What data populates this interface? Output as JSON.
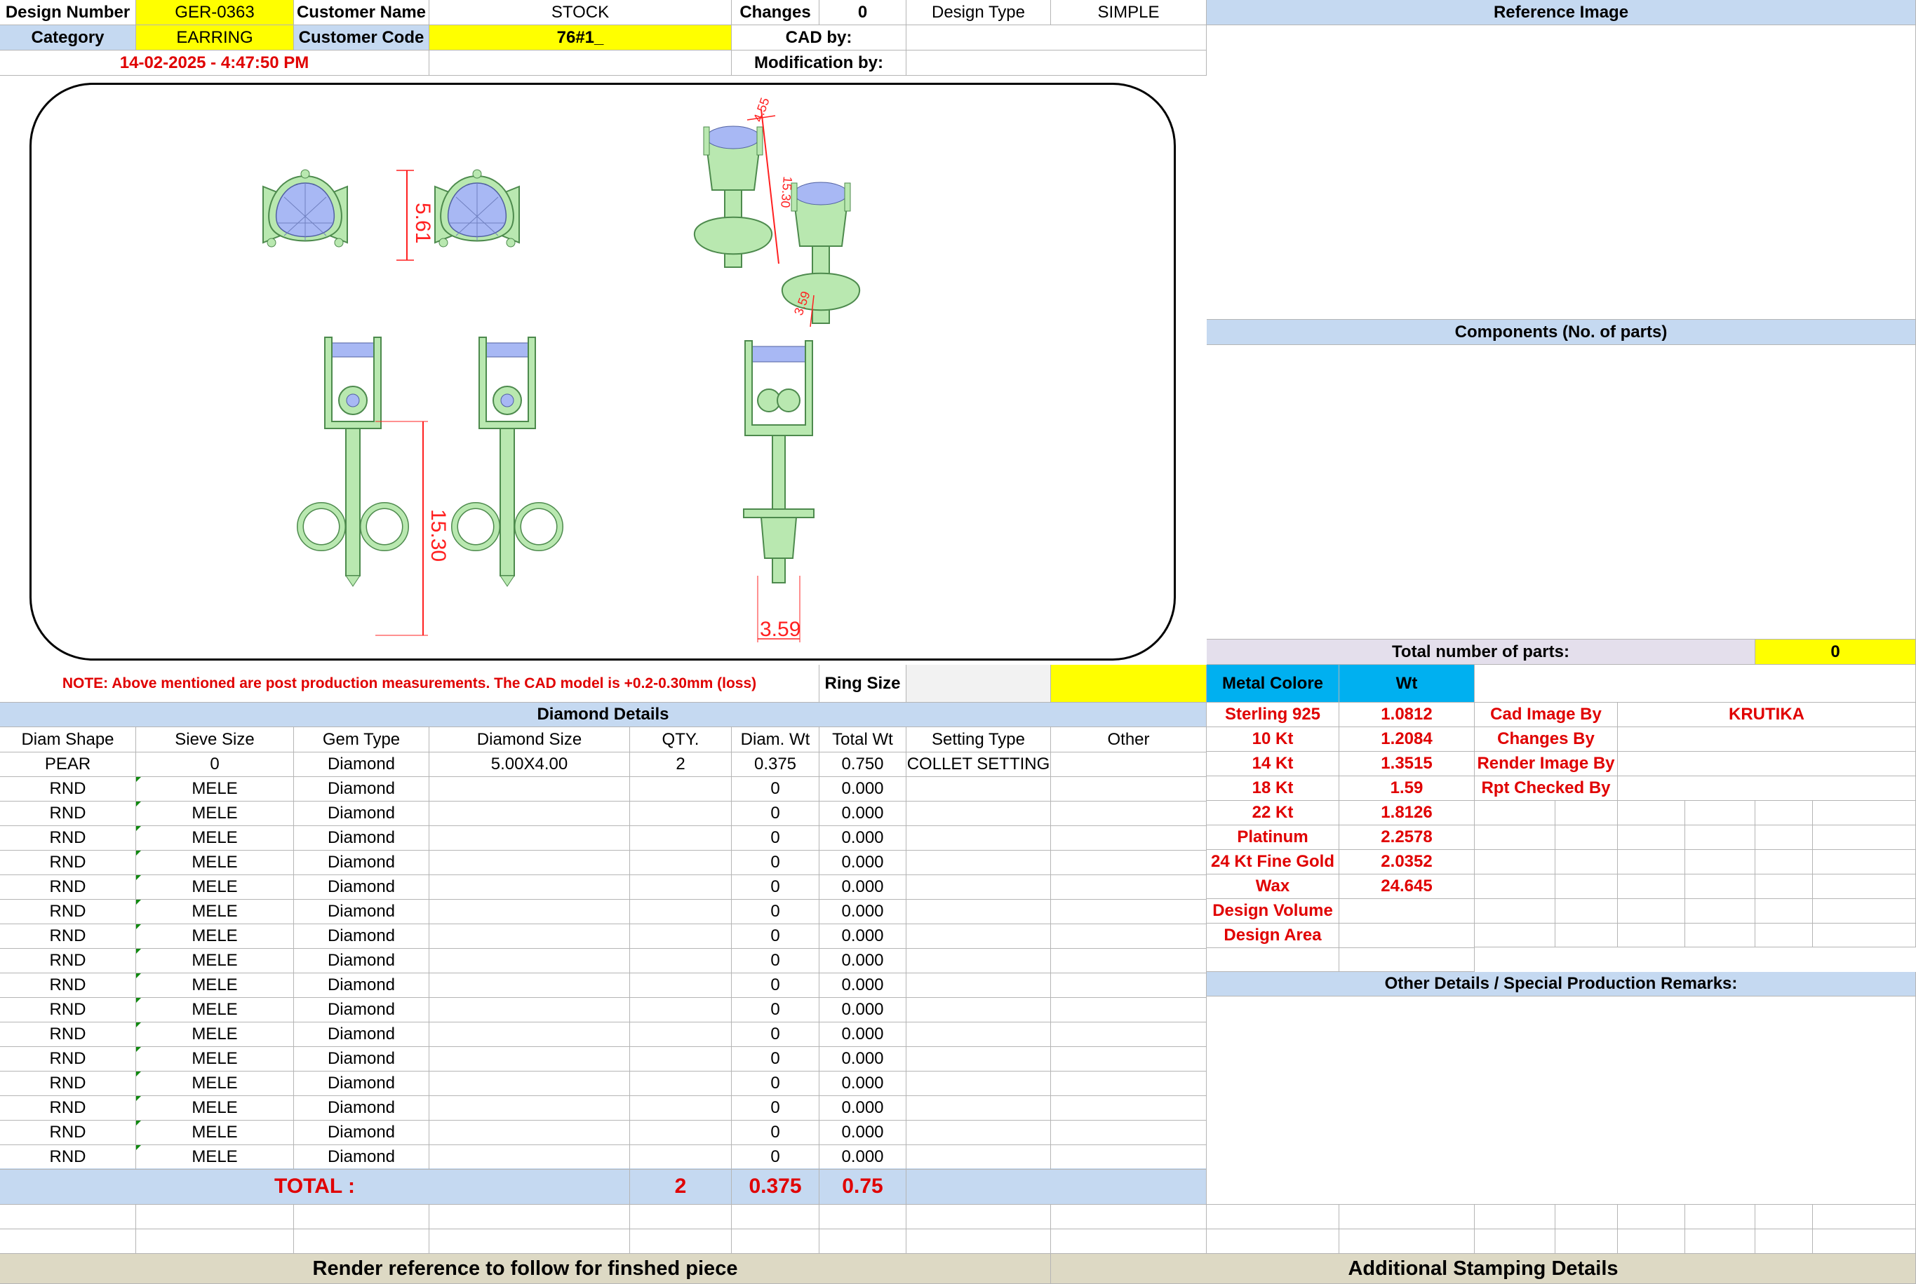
{
  "header": {
    "design_number_label": "Design Number",
    "design_number": "GER-0363",
    "customer_name_label": "Customer Name",
    "customer_name": "STOCK",
    "changes_label": "Changes",
    "changes": "0",
    "design_type_label": "Design Type",
    "design_type": "SIMPLE",
    "reference_image_label": "Reference Image",
    "category_label": "Category",
    "category": "EARRING",
    "customer_code_label": "Customer Code",
    "customer_code": "76#1_",
    "cad_by_label": "CAD by:",
    "datetime": "14-02-2025 - 4:47:50 PM",
    "modification_by_label": "Modification by:"
  },
  "drawing": {
    "dims": {
      "top_width": "5.61",
      "side_height": "15.30",
      "side_small1": "4.55",
      "side_small2": "3.59",
      "front_height": "15.30",
      "bottom_width": "3.59"
    }
  },
  "note": "NOTE: Above mentioned are post production measurements. The CAD model is +0.2-0.30mm (loss)",
  "ring_size_label": "Ring Size",
  "diamond": {
    "section_title": "Diamond Details",
    "headers": [
      "Diam Shape",
      "Sieve Size",
      "Gem Type",
      "Diamond Size",
      "QTY.",
      "Diam. Wt",
      "Total Wt",
      "Setting Type",
      "Other"
    ],
    "rows": [
      [
        "PEAR",
        "0",
        "Diamond",
        "5.00X4.00",
        "2",
        "0.375",
        "0.750",
        "COLLET SETTING",
        ""
      ],
      [
        "RND",
        "MELE",
        "Diamond",
        "",
        "",
        "0",
        "0.000",
        "",
        ""
      ],
      [
        "RND",
        "MELE",
        "Diamond",
        "",
        "",
        "0",
        "0.000",
        "",
        ""
      ],
      [
        "RND",
        "MELE",
        "Diamond",
        "",
        "",
        "0",
        "0.000",
        "",
        ""
      ],
      [
        "RND",
        "MELE",
        "Diamond",
        "",
        "",
        "0",
        "0.000",
        "",
        ""
      ],
      [
        "RND",
        "MELE",
        "Diamond",
        "",
        "",
        "0",
        "0.000",
        "",
        ""
      ],
      [
        "RND",
        "MELE",
        "Diamond",
        "",
        "",
        "0",
        "0.000",
        "",
        ""
      ],
      [
        "RND",
        "MELE",
        "Diamond",
        "",
        "",
        "0",
        "0.000",
        "",
        ""
      ],
      [
        "RND",
        "MELE",
        "Diamond",
        "",
        "",
        "0",
        "0.000",
        "",
        ""
      ],
      [
        "RND",
        "MELE",
        "Diamond",
        "",
        "",
        "0",
        "0.000",
        "",
        ""
      ],
      [
        "RND",
        "MELE",
        "Diamond",
        "",
        "",
        "0",
        "0.000",
        "",
        ""
      ],
      [
        "RND",
        "MELE",
        "Diamond",
        "",
        "",
        "0",
        "0.000",
        "",
        ""
      ],
      [
        "RND",
        "MELE",
        "Diamond",
        "",
        "",
        "0",
        "0.000",
        "",
        ""
      ],
      [
        "RND",
        "MELE",
        "Diamond",
        "",
        "",
        "0",
        "0.000",
        "",
        ""
      ],
      [
        "RND",
        "MELE",
        "Diamond",
        "",
        "",
        "0",
        "0.000",
        "",
        ""
      ],
      [
        "RND",
        "MELE",
        "Diamond",
        "",
        "",
        "0",
        "0.000",
        "",
        ""
      ],
      [
        "RND",
        "MELE",
        "Diamond",
        "",
        "",
        "0",
        "0.000",
        "",
        ""
      ]
    ],
    "total_label": "TOTAL :",
    "total_qty": "2",
    "total_diam_wt": "0.375",
    "total_wt": "0.75"
  },
  "components": {
    "title": "Components (No. of parts)",
    "total_parts_label": "Total number of parts:",
    "total_parts": "0"
  },
  "metal": {
    "header_color": "Metal Colore",
    "header_wt": "Wt",
    "rows": [
      [
        "Sterling 925",
        "1.0812"
      ],
      [
        "10 Kt",
        "1.2084"
      ],
      [
        "14 Kt",
        "1.3515"
      ],
      [
        "18 Kt",
        "1.59"
      ],
      [
        "22 Kt",
        "1.8126"
      ],
      [
        "Platinum",
        "2.2578"
      ],
      [
        "24 Kt Fine Gold",
        "2.0352"
      ],
      [
        "Wax",
        "24.645"
      ],
      [
        "Design Volume",
        ""
      ],
      [
        "Design Area",
        ""
      ]
    ]
  },
  "credits": [
    [
      "Cad Image By",
      "KRUTIKA"
    ],
    [
      "Changes By",
      ""
    ],
    [
      "Render Image By",
      ""
    ],
    [
      "Rpt Checked By",
      ""
    ]
  ],
  "other_details_title": "Other Details / Special Production Remarks:",
  "footer": {
    "render_reference": "Render reference to follow for finshed piece",
    "stamping": "Additional Stamping Details"
  },
  "colors": {
    "yellow": "#ffff00",
    "header_blue": "#c5d9f1",
    "metal_cyan": "#00b0f0",
    "footer_tan": "#ddd9c4",
    "metal_green": "#b9e8b0",
    "stone_blue": "#a8b8f4"
  }
}
